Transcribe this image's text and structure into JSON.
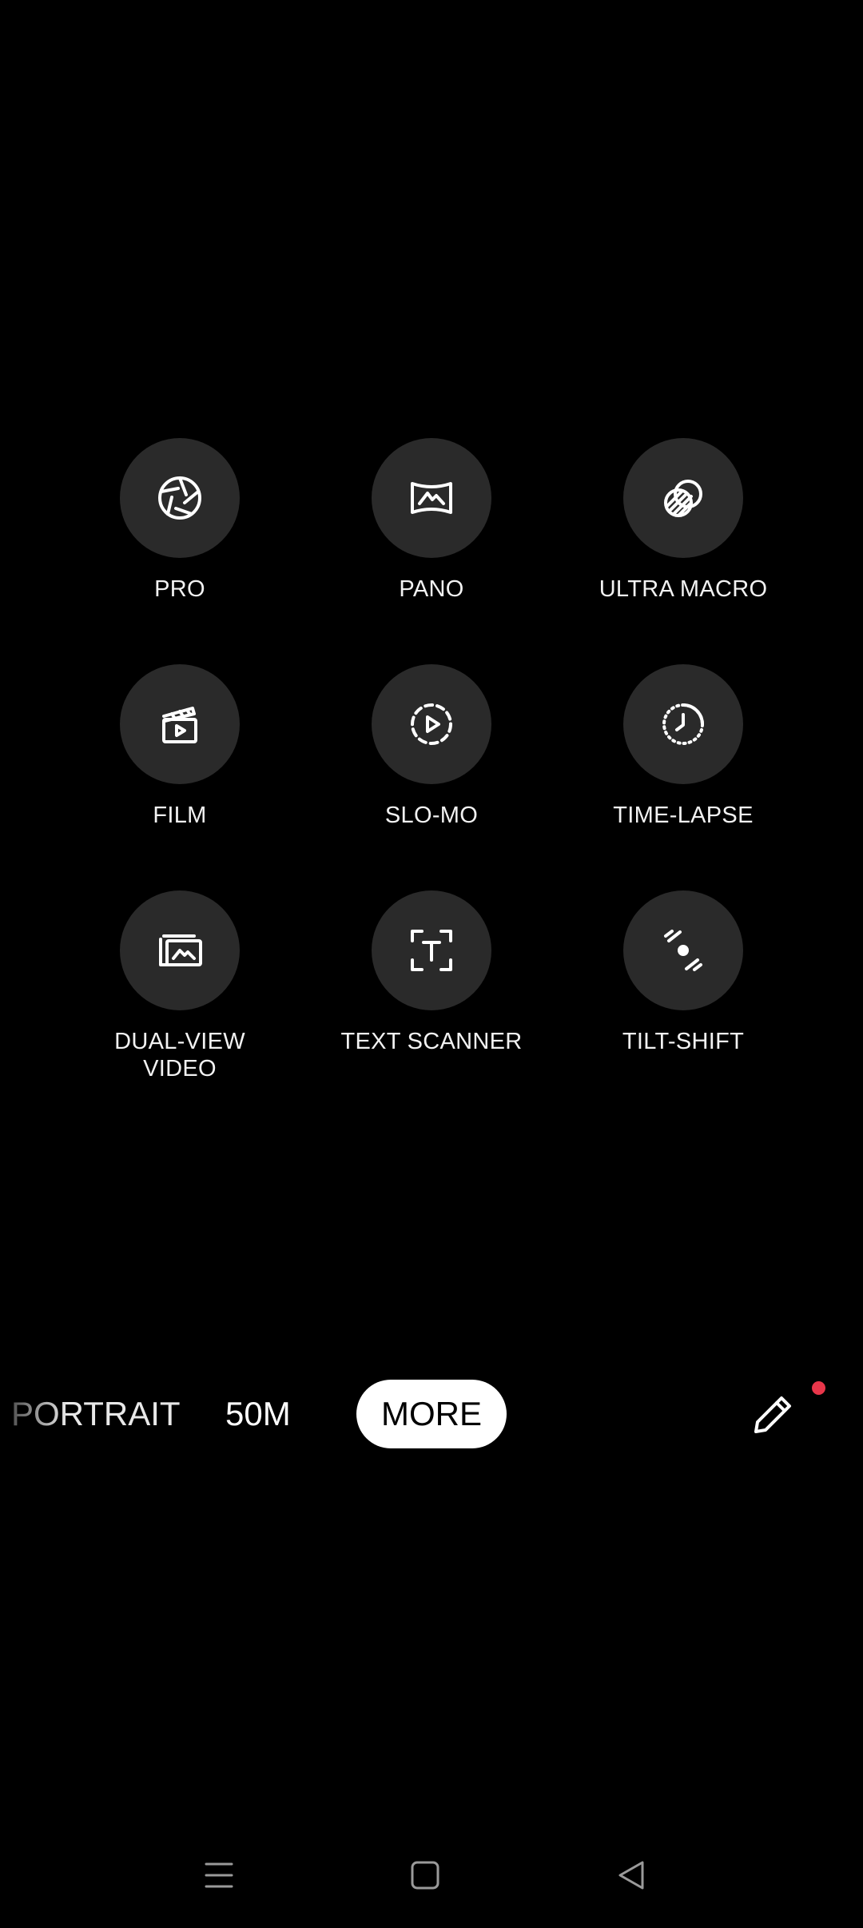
{
  "colors": {
    "background": "#000000",
    "tile": "#2a2a2a",
    "selected_pill": "#ffffff",
    "notification_dot": "#e8364a"
  },
  "modes": [
    {
      "label_lines": [
        "PRO"
      ],
      "icon": "aperture-icon"
    },
    {
      "label_lines": [
        "PANO"
      ],
      "icon": "panorama-icon"
    },
    {
      "label_lines": [
        "ULTRA MACRO"
      ],
      "icon": "macro-icon"
    },
    {
      "label_lines": [
        "FILM"
      ],
      "icon": "film-icon"
    },
    {
      "label_lines": [
        "SLO-MO"
      ],
      "icon": "slow-motion-icon"
    },
    {
      "label_lines": [
        "TIME-LAPSE"
      ],
      "icon": "time-lapse-icon"
    },
    {
      "label_lines": [
        "DUAL-VIEW",
        "VIDEO"
      ],
      "icon": "dual-view-icon"
    },
    {
      "label_lines": [
        "TEXT SCANNER"
      ],
      "icon": "text-scanner-icon"
    },
    {
      "label_lines": [
        "TILT-SHIFT"
      ],
      "icon": "tilt-shift-icon"
    }
  ],
  "mode_strip": {
    "portrait": "PORTRAIT",
    "fifty_m": "50M",
    "more": "MORE",
    "selected": "MORE"
  },
  "edit": {
    "icon": "pencil-icon",
    "has_notification": true
  },
  "nav": {
    "menu_icon": "menu-icon",
    "home_icon": "home-square-icon",
    "back_icon": "back-triangle-icon"
  }
}
